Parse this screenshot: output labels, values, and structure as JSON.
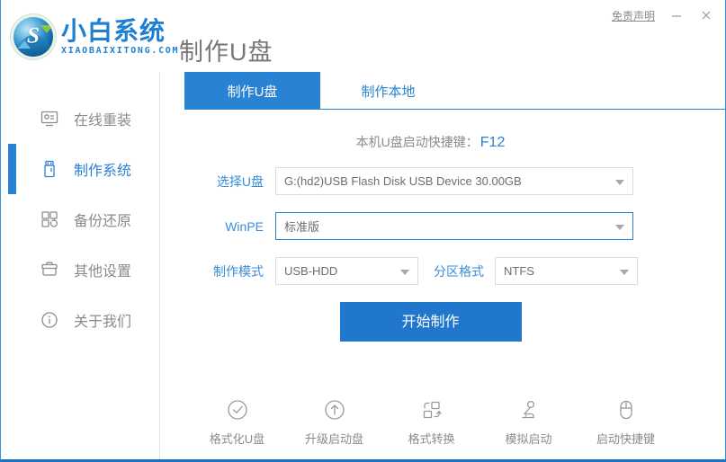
{
  "window": {
    "title": "制作U盘",
    "disclaimer_label": "免责声明",
    "minimize_label": "minimize-icon",
    "close_label": "close-icon",
    "accent_color": "#2a82d4",
    "primary_button_color": "#2077cc"
  },
  "brand": {
    "name_cn": "小白系统",
    "name_en": "XIAOBAIXITONG.COM",
    "glyph": "S"
  },
  "sidebar": {
    "items": [
      {
        "label": "在线重装",
        "icon": "monitor-icon",
        "active": false
      },
      {
        "label": "制作系统",
        "icon": "usb-icon",
        "active": true
      },
      {
        "label": "备份还原",
        "icon": "backup-icon",
        "active": false
      },
      {
        "label": "其他设置",
        "icon": "toolbox-icon",
        "active": false
      },
      {
        "label": "关于我们",
        "icon": "info-icon",
        "active": false
      }
    ]
  },
  "main": {
    "tabs": [
      {
        "label": "制作U盘",
        "active": true
      },
      {
        "label": "制作本地",
        "active": false
      }
    ],
    "hint": {
      "text": "本机U盘启动快捷键：",
      "hotkey": "F12"
    },
    "form": {
      "usb": {
        "label": "选择U盘",
        "value": "G:(hd2)USB Flash Disk USB Device 30.00GB"
      },
      "winpe": {
        "label": "WinPE",
        "value": "标准版"
      },
      "mode": {
        "label": "制作模式",
        "value": "USB-HDD"
      },
      "partition": {
        "label": "分区格式",
        "value": "NTFS"
      }
    },
    "primary_button": "开始制作",
    "tools": [
      {
        "label": "格式化U盘",
        "icon": "check-circle-icon"
      },
      {
        "label": "升级启动盘",
        "icon": "arrow-up-circle-icon"
      },
      {
        "label": "格式转换",
        "icon": "convert-icon"
      },
      {
        "label": "模拟启动",
        "icon": "joystick-icon"
      },
      {
        "label": "启动快捷键",
        "icon": "mouse-icon"
      }
    ]
  }
}
